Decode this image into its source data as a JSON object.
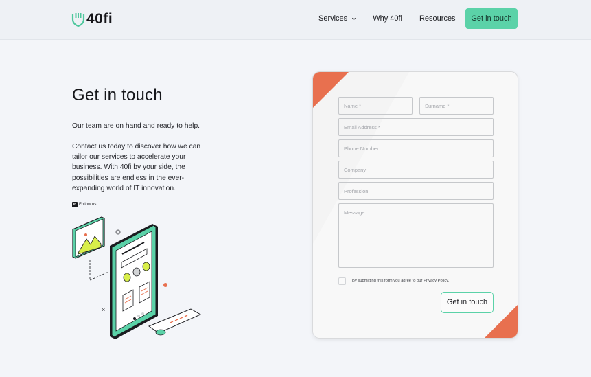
{
  "header": {
    "logo_text": "40fi",
    "nav": [
      {
        "label": "Services",
        "has_dropdown": true
      },
      {
        "label": "Why 40fi"
      },
      {
        "label": "Resources"
      }
    ],
    "cta_label": "Get in touch"
  },
  "hero": {
    "title": "Get in touch",
    "lead": "Our team are on hand and ready to help.",
    "body": "Contact us today to discover how we can tailor our services to accelerate your business. With 40fi by your side, the possibilities are endless in the ever-expanding world of IT innovation.",
    "follow_label": "Follow us"
  },
  "form": {
    "name_placeholder": "Name *",
    "surname_placeholder": "Surname *",
    "email_placeholder": "Email Address *",
    "phone_placeholder": "Phone Number",
    "company_placeholder": "Company",
    "profession_placeholder": "Profession",
    "message_placeholder": "Message",
    "consent_text": "By submitting this form you agree to our Privacy Policy.",
    "submit_label": "Get in touch"
  },
  "colors": {
    "accent_green": "#5bd2a8",
    "accent_orange": "#e8704f",
    "background": "#f3f5f9"
  }
}
